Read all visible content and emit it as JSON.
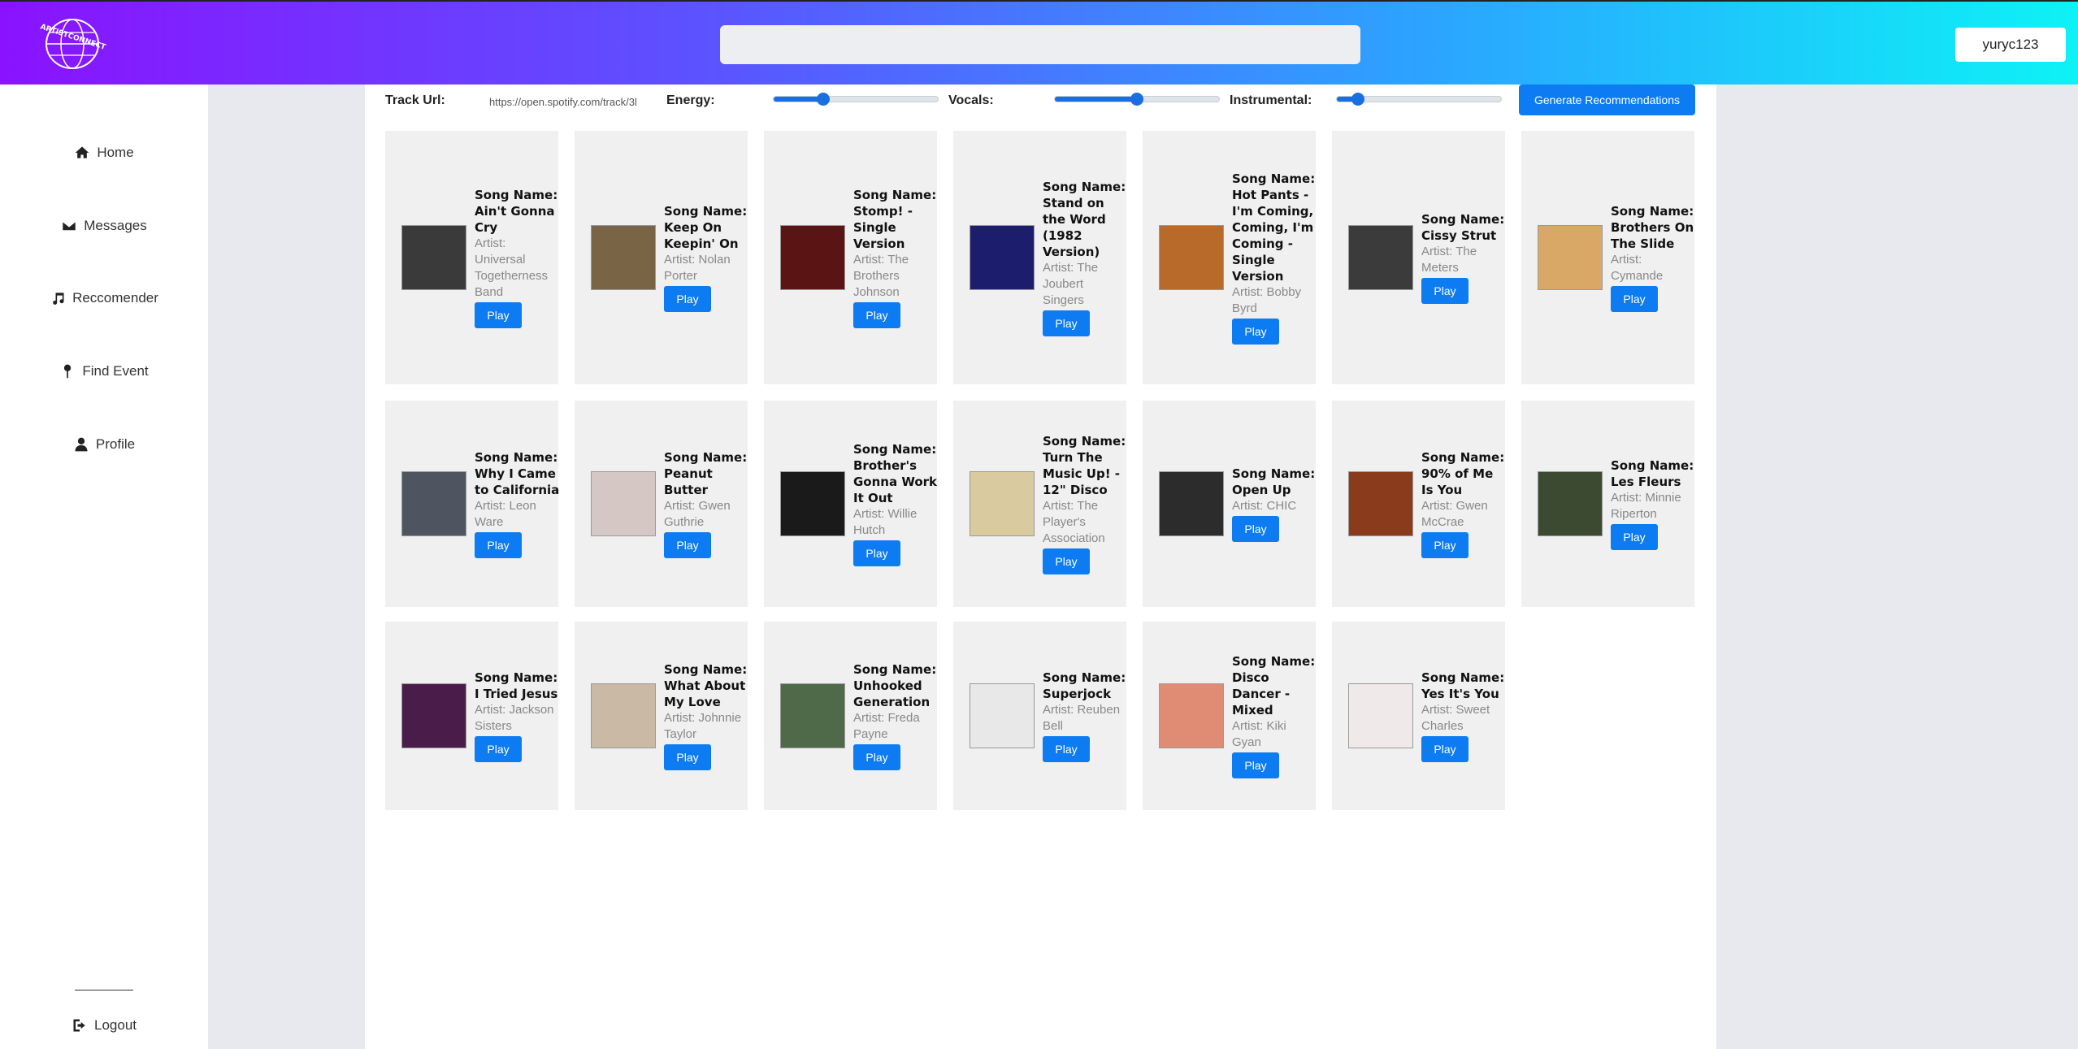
{
  "header": {
    "logo_text": "ARTISTCONNECT",
    "search_placeholder": "",
    "user_label": "yuryc123"
  },
  "sidebar": {
    "items": [
      {
        "label": "Home",
        "icon": "home-icon"
      },
      {
        "label": "Messages",
        "icon": "envelope-icon"
      },
      {
        "label": "Reccomender",
        "icon": "music-note-icon"
      },
      {
        "label": "Find Event",
        "icon": "map-pin-icon"
      },
      {
        "label": "Profile",
        "icon": "user-icon"
      }
    ],
    "logout_label": "Logout"
  },
  "controls": {
    "track_url_label": "Track Url:",
    "track_url_value": "https://open.spotify.com/track/3l",
    "energy_label": "Energy:",
    "energy_value": 0.3,
    "vocals_label": "Vocals:",
    "vocals_value": 0.5,
    "instrumental_label": "Instrumental:",
    "instrumental_value": 0.13,
    "generate_label": "Generate Recommendations",
    "accent_color": "#0d7cf2"
  },
  "songs": [
    {
      "name": "Song Name: Ain't Gonna Cry",
      "artist": "Artist: Universal Togetherness Band"
    },
    {
      "name": "Song Name: Keep On Keepin' On",
      "artist": "Artist: Nolan Porter"
    },
    {
      "name": "Song Name: Stomp! - Single Version",
      "artist": "Artist: The Brothers Johnson"
    },
    {
      "name": "Song Name: Stand on the Word (1982 Version)",
      "artist": "Artist: The Joubert Singers"
    },
    {
      "name": "Song Name: Hot Pants - I'm Coming, Coming, I'm Coming - Single Version",
      "artist": "Artist: Bobby Byrd"
    },
    {
      "name": "Song Name: Cissy Strut",
      "artist": "Artist: The Meters"
    },
    {
      "name": "Song Name: Brothers On The Slide",
      "artist": "Artist: Cymande"
    },
    {
      "name": "Song Name: Why I Came to California",
      "artist": "Artist: Leon Ware"
    },
    {
      "name": "Song Name: Peanut Butter",
      "artist": "Artist: Gwen Guthrie"
    },
    {
      "name": "Song Name: Brother's Gonna Work It Out",
      "artist": "Artist: Willie Hutch"
    },
    {
      "name": "Song Name: Turn The Music Up! - 12\" Disco",
      "artist": "Artist: The Player's Association"
    },
    {
      "name": "Song Name: Open Up",
      "artist": "Artist: CHIC"
    },
    {
      "name": "Song Name: 90% of Me Is You",
      "artist": "Artist: Gwen McCrae"
    },
    {
      "name": "Song Name: Les Fleurs",
      "artist": "Artist: Minnie Riperton"
    },
    {
      "name": "Song Name: I Tried Jesus",
      "artist": "Artist: Jackson Sisters"
    },
    {
      "name": "Song Name: What About My Love",
      "artist": "Artist: Johnnie Taylor"
    },
    {
      "name": "Song Name: Unhooked Generation",
      "artist": "Artist: Freda Payne"
    },
    {
      "name": "Song Name: Superjock",
      "artist": "Artist: Reuben Bell"
    },
    {
      "name": "Song Name: Disco Dancer - Mixed",
      "artist": "Artist: Kiki Gyan"
    },
    {
      "name": "Song Name: Yes It's You",
      "artist": "Artist: Sweet Charles"
    }
  ],
  "play_label": "Play"
}
